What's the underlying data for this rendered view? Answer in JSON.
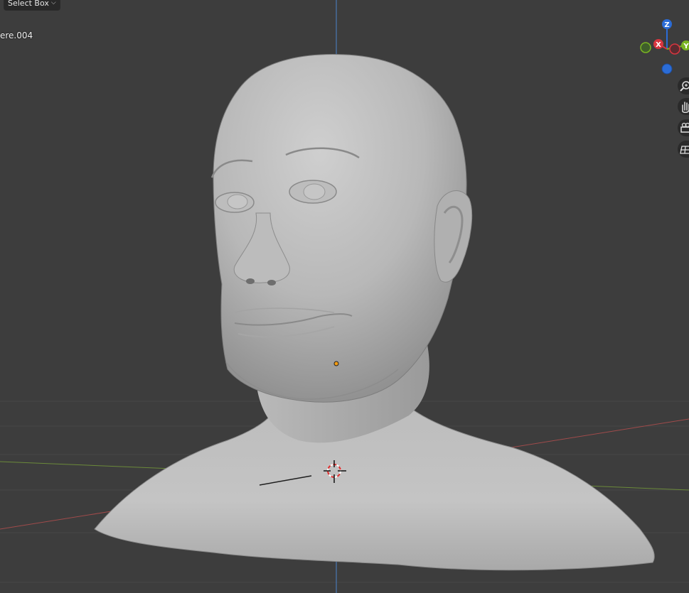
{
  "header": {
    "select_mode_label": "Select Box",
    "object_name": "ere.004"
  },
  "gizmo": {
    "axes": [
      {
        "label": "Z",
        "color": "#2b6cd6"
      },
      {
        "label": "X",
        "color": "#d8353f"
      },
      {
        "label": "Y",
        "color": "#7ab422"
      }
    ]
  },
  "navigation": {
    "buttons": [
      "zoom-icon",
      "hand-pan-icon",
      "camera-icon",
      "grid-perspective-icon"
    ]
  },
  "colors": {
    "background": "#3d3d3d",
    "x_axis_line": "#a04b4b",
    "y_axis_line": "#6b8a3a",
    "z_axis_line": "#4a78b5",
    "origin_dot": "#f39c12"
  }
}
